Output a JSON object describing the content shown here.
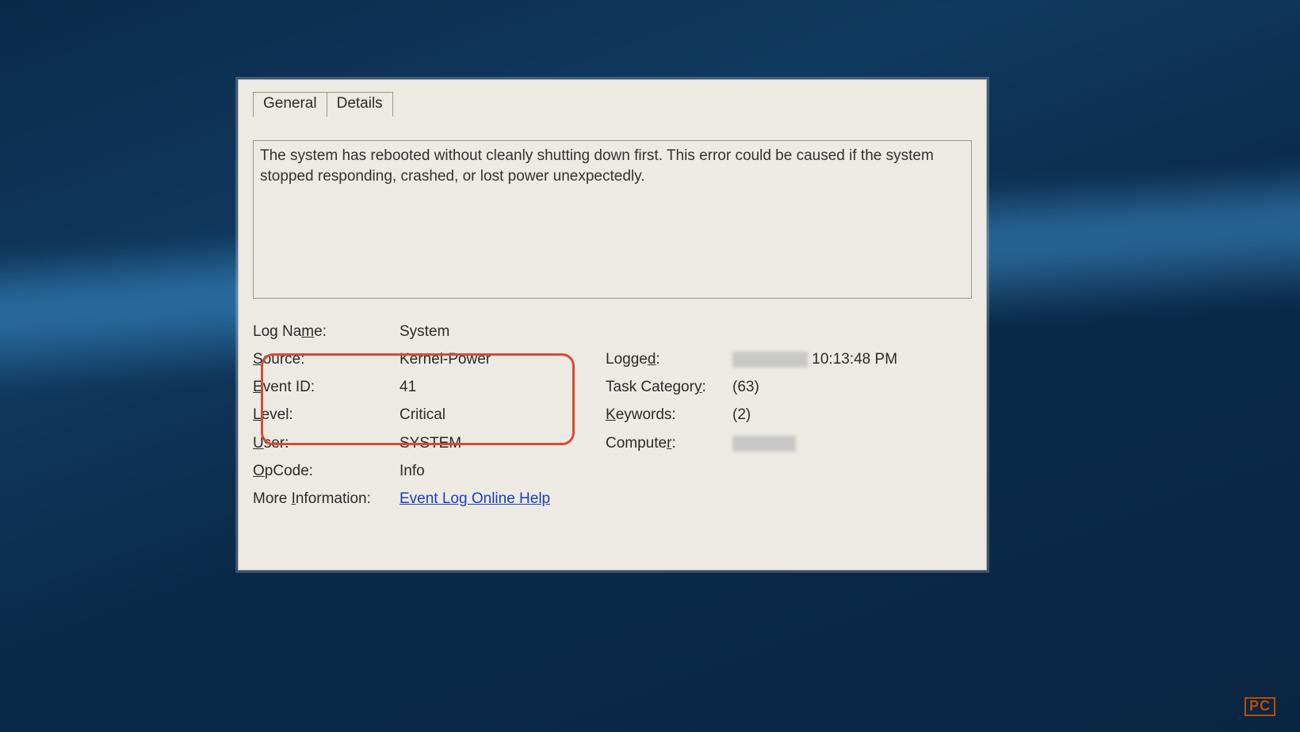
{
  "tabs": {
    "general": "General",
    "details": "Details"
  },
  "description": "The system has rebooted without cleanly shutting down first. This error could be caused if the system stopped responding, crashed, or lost power unexpectedly.",
  "fields": {
    "log_name_label": "Log Name:",
    "log_name_value": "System",
    "source_label": "Source:",
    "source_value": "Kernel-Power",
    "logged_label": "Logged:",
    "logged_value": "10:13:48 PM",
    "event_id_label": "Event ID:",
    "event_id_value": "41",
    "task_category_label": "Task Category:",
    "task_category_value": "(63)",
    "level_label": "Level:",
    "level_value": "Critical",
    "keywords_label": "Keywords:",
    "keywords_value": "(2)",
    "user_label": "User:",
    "user_value": "SYSTEM",
    "computer_label": "Computer:",
    "opcode_label": "OpCode:",
    "opcode_value": "Info",
    "more_info_label": "More Information:",
    "more_info_link": "Event Log Online Help"
  },
  "watermark": {
    "left": "",
    "badge": "PC",
    "right": ""
  }
}
